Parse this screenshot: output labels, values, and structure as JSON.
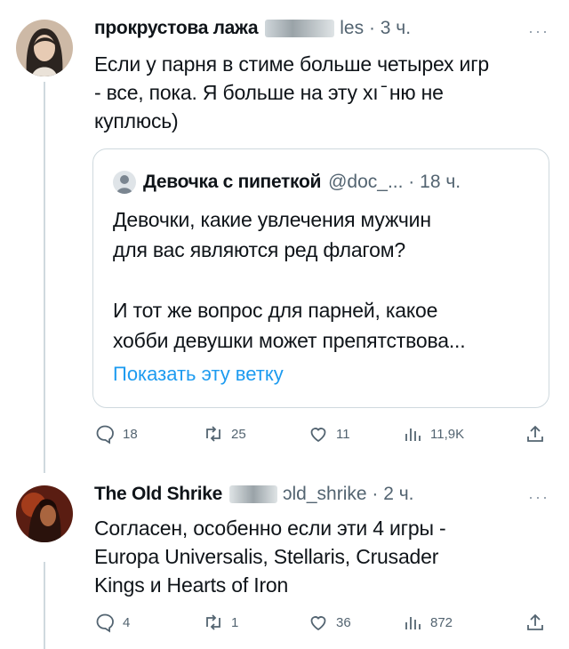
{
  "post": {
    "author": "прокрустова лажа",
    "handle": "les",
    "time": "3 ч.",
    "more": "···",
    "lines": [
      "Если у парня в стиме больше четырех игр",
      "- все, пока. Я больше на эту хı ̄ ню не",
      "куплюсь)"
    ],
    "quote": {
      "author": "Девочка с пипеткой",
      "handle": "@doc_...",
      "time": "18 ч.",
      "lines": [
        "Девочки, какие увлечения мужчин",
        "для вас являются ред флагом?",
        "",
        "И тот же вопрос для парней, какое",
        "хобби девушки может препятствова..."
      ],
      "link": "Показать эту ветку"
    },
    "stats": {
      "replies": "18",
      "reposts": "25",
      "likes": "11",
      "views": "11,9K"
    }
  },
  "reply": {
    "author": "The Old Shrike",
    "handle": "ɔld_shrike",
    "time": "2 ч.",
    "more": "···",
    "lines": [
      "Согласен, особенно если эти 4 игры -",
      "Europa Universalis, Stellaris, Crusader",
      "Kings и Hearts of Iron"
    ],
    "stats": {
      "replies": "4",
      "reposts": "1",
      "likes": "36",
      "views": "872"
    }
  },
  "icons": [
    "reply-icon",
    "repost-icon",
    "like-icon",
    "views-icon",
    "share-icon"
  ],
  "colors": {
    "link": "#1d9bf0",
    "muted": "#536471",
    "border": "#cfd9de"
  }
}
